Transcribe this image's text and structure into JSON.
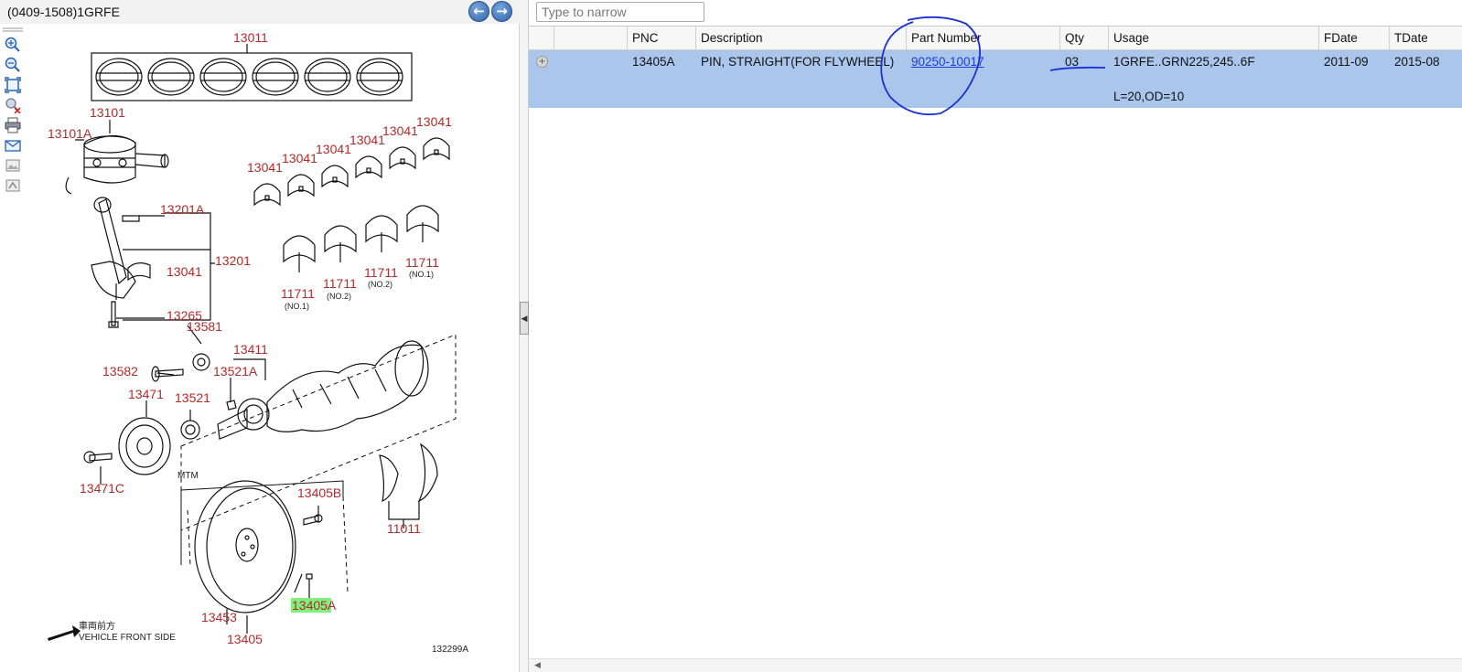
{
  "left_title": "(0409-1508)1GRFE",
  "nav": {
    "back_glyph": "←",
    "forward_glyph": "→"
  },
  "toolbar_icons": [
    "zoom-in-icon",
    "zoom-out-icon",
    "fit-icon",
    "clear-highlight-icon",
    "print-icon",
    "email-icon",
    "image-icon",
    "export-icon"
  ],
  "diagram": {
    "labels": {
      "l13011": "13011",
      "l13101": "13101",
      "l13101A": "13101A",
      "l13041a": "13041",
      "l13041b": "13041",
      "l13041c": "13041",
      "l13041d": "13041",
      "l13041e": "13041",
      "l13041f": "13041",
      "l13041g": "13041",
      "l13201A": "13201A",
      "l13201": "13201",
      "l13265": "13265",
      "l11711a": "11711",
      "l11711b": "11711",
      "l11711c": "11711",
      "l11711d": "11711",
      "n1a": "(NO.1)",
      "n2a": "(NO.2)",
      "n2b": "(NO.2)",
      "n1b": "(NO.1)",
      "l13581": "13581",
      "l13411": "13411",
      "l13582": "13582",
      "l13521A": "13521A",
      "l13471": "13471",
      "l13521": "13521",
      "l13471C": "13471C",
      "mtm": "MTM",
      "l13405B": "13405B",
      "l11011": "11011",
      "l13405A": "13405A",
      "l13453": "13453",
      "l13405": "13405",
      "front_jp": "車両前方",
      "front_en": "VEHICLE FRONT SIDE",
      "ref": "132299A"
    }
  },
  "filter": {
    "placeholder": "Type to narrow"
  },
  "columns": {
    "pnc": "PNC",
    "description": "Description",
    "part_number": "Part Number",
    "qty": "Qty",
    "usage": "Usage",
    "fdate": "FDate",
    "tdate": "TDate"
  },
  "rows": [
    {
      "pnc": "13405A",
      "description": "PIN, STRAIGHT(FOR FLYWHEEL)",
      "part_number": "90250-10017",
      "qty": "03",
      "usage": "1GRFE..GRN225,245..6F",
      "usage_note": "L=20,OD=10",
      "fdate": "2011-09",
      "tdate": "2015-08"
    }
  ],
  "colors": {
    "selected_row": "#aac6ec",
    "annotation": "#1a2fd6",
    "label_red": "#b22a2a",
    "highlight": "#7ff07f"
  }
}
